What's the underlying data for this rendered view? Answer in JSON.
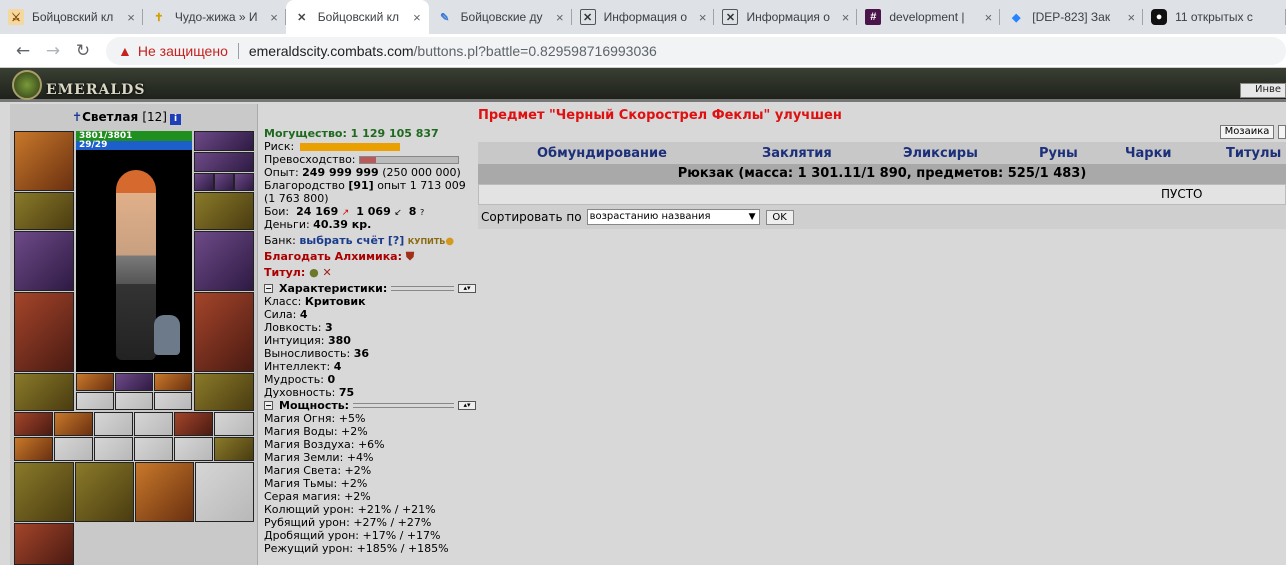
{
  "browser": {
    "tabs": [
      {
        "title": "Бойцовский кл",
        "icon": "sword-crossed-icon"
      },
      {
        "title": "Чудо-жижа » И",
        "icon": "cross-icon"
      },
      {
        "title": "Бойцовский кл",
        "icon": "swords-icon",
        "active": true
      },
      {
        "title": "Бойцовские ду",
        "icon": "feather-icon"
      },
      {
        "title": "Информация о",
        "icon": "swords-icon"
      },
      {
        "title": "Информация о",
        "icon": "swords-icon"
      },
      {
        "title": "development |",
        "icon": "slack-icon"
      },
      {
        "title": "[DEP-823] Зак",
        "icon": "jira-icon"
      },
      {
        "title": "11 открытых с",
        "icon": "app-icon"
      }
    ],
    "security_label": "Не защищено",
    "url_host": "emeraldscity.combats.com",
    "url_path": "/buttons.pl?battle=0.829598716993036"
  },
  "banner": {
    "logo_text": "EMERALDS",
    "inv_label": "Инве"
  },
  "character": {
    "name": "Светлая",
    "level": "[12]",
    "hp": "3801/3801",
    "mp": "29/29"
  },
  "stats": {
    "power_label": "Могущество: 1 129 105 837",
    "risk_label": "Риск:",
    "excellence_label": "Превосходство:",
    "exp": "Опыт:",
    "exp_value": "249 999 999",
    "exp_next": "(250 000 000)",
    "nobility": "Благородство",
    "nobility_level": "[91]",
    "nobility_exp": "опыт 1 713 009",
    "nobility_next": "(1 763 800)",
    "battles_label": "Бои:",
    "battles_won": "24 169",
    "battles_lost": "1 069",
    "battles_draw": "8",
    "money_label": "Деньги:",
    "money_value": "40.39 кр.",
    "bank_label": "Банк:",
    "bank_link": "выбрать счёт",
    "bank_help": "[?]",
    "bank_buy": "КУПИТЬ",
    "blessing": "Благодать Алхимика:",
    "title_label": "Титул:",
    "chars_header": "Характеристики:",
    "class_label": "Класс:",
    "class_value": "Критовик",
    "attributes": [
      {
        "label": "Сила:",
        "value": "4"
      },
      {
        "label": "Ловкость:",
        "value": "3"
      },
      {
        "label": "Интуиция:",
        "value": "380"
      },
      {
        "label": "Выносливость:",
        "value": "36"
      },
      {
        "label": "Интеллект:",
        "value": "4"
      },
      {
        "label": "Мудрость:",
        "value": "0"
      },
      {
        "label": "Духовность:",
        "value": "75"
      }
    ],
    "power_header": "Мощность:",
    "powers": [
      "Магия Огня: +5%",
      "Магия Воды: +2%",
      "Магия Воздуха: +6%",
      "Магия Земли: +4%",
      "Магия Света: +2%",
      "Магия Тьмы: +2%",
      "Серая магия: +2%",
      "Колющий урон: +21% / +21%",
      "Рубящий урон: +27% / +27%",
      "Дробящий урон: +17% / +17%",
      "Режущий урон: +185% / +185%"
    ]
  },
  "main": {
    "notice": "Предмет \"Черный Скорострел Феклы\" улучшен",
    "mosaic_button": "Мозаика",
    "tabs": [
      "Обмундирование",
      "Заклятия",
      "Эликсиры",
      "Руны",
      "Чарки",
      "Титулы"
    ],
    "backpack_line": "Рюкзак (масса: 1 301.11/1 890, предметов: 525/1 483)",
    "empty_label": "ПУСТО",
    "sort_label": "Сортировать по",
    "sort_value": "возрастанию названия",
    "ok_label": "OK"
  }
}
